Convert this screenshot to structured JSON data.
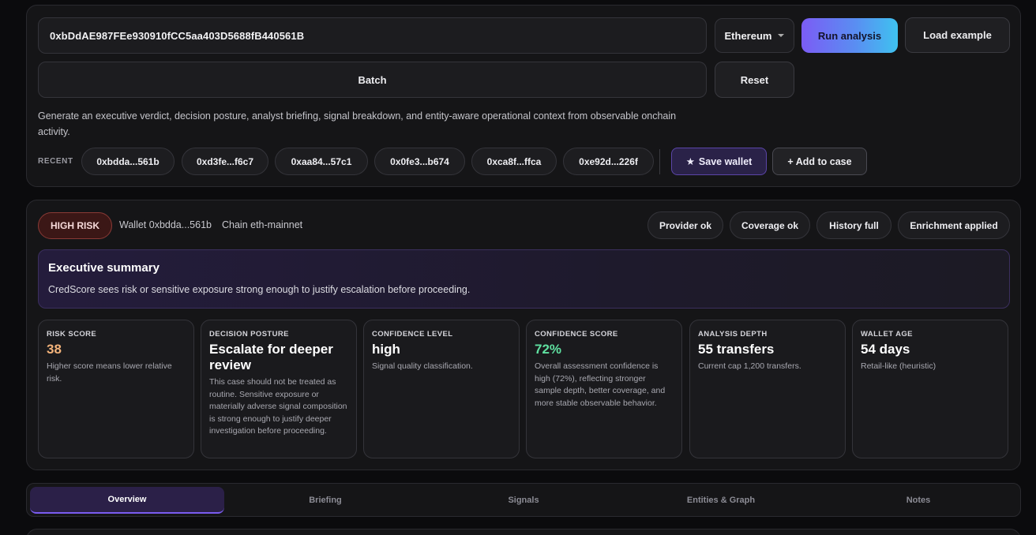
{
  "search": {
    "address": "0xbDdAE987FEe930910fCC5aa403D5688fB440561B",
    "chain": "Ethereum",
    "run_label": "Run analysis",
    "load_label": "Load example",
    "batch_label": "Batch",
    "reset_label": "Reset",
    "description": "Generate an executive verdict, decision posture, analyst briefing, signal breakdown, and entity-aware operational context from observable onchain activity."
  },
  "recent": {
    "label": "RECENT",
    "items": [
      "0xbdda...561b",
      "0xd3fe...f6c7",
      "0xaa84...57c1",
      "0x0fe3...b674",
      "0xca8f...ffca",
      "0xe92d...226f"
    ],
    "save_label": "Save wallet",
    "add_case_label": "+ Add to case"
  },
  "result": {
    "risk_badge": "HIGH RISK",
    "wallet": "Wallet 0xbdda...561b",
    "chain": "Chain eth-mainnet",
    "statuses": [
      "Provider ok",
      "Coverage ok",
      "History full",
      "Enrichment applied"
    ],
    "summary_title": "Executive summary",
    "summary_text": "CredScore sees risk or sensitive exposure strong enough to justify escalation before proceeding.",
    "cards": [
      {
        "label": "RISK SCORE",
        "value": "38",
        "desc": "Higher score means lower relative risk.",
        "color": "#f2b27a"
      },
      {
        "label": "DECISION POSTURE",
        "value": "Escalate for deeper review",
        "desc": "This case should not be treated as routine. Sensitive exposure or materially adverse signal composition is strong enough to justify deeper investigation before proceeding.",
        "color": "#ffffff"
      },
      {
        "label": "CONFIDENCE LEVEL",
        "value": "high",
        "desc": "Signal quality classification.",
        "color": "#ffffff"
      },
      {
        "label": "CONFIDENCE SCORE",
        "value": "72%",
        "desc": "Overall assessment confidence is high (72%), reflecting stronger sample depth, better coverage, and more stable observable behavior.",
        "color": "#5fe0a0"
      },
      {
        "label": "ANALYSIS DEPTH",
        "value": "55 transfers",
        "desc": "Current cap 1,200 transfers.",
        "color": "#ffffff"
      },
      {
        "label": "WALLET AGE",
        "value": "54 days",
        "desc": "Retail-like (heuristic)",
        "color": "#ffffff"
      }
    ]
  },
  "tabs": [
    "Overview",
    "Briefing",
    "Signals",
    "Entities & Graph",
    "Notes"
  ]
}
